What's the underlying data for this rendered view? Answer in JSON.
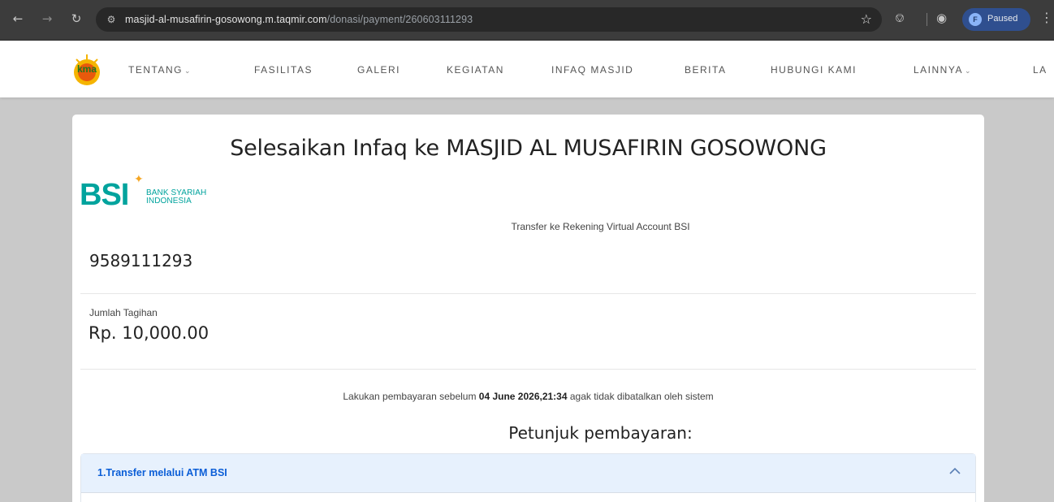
{
  "browser": {
    "url_host": "masjid-al-musafirin-gosowong.m.taqmir.com",
    "url_path": "/donasi/payment/260603111293",
    "profile_initial": "F",
    "profile_status": "Paused",
    "back_icon": "arrow-left-icon",
    "forward_icon": "arrow-right-icon",
    "reload_icon": "reload-icon",
    "site_info_icon": "tune-icon",
    "bookmark_icon": "star-icon",
    "extensions_icon": "puzzle-icon",
    "menu_icon": "kebab-menu-icon"
  },
  "nav": {
    "logo_text": "kma",
    "items": [
      {
        "label": "TENTANG",
        "has_dropdown": true
      },
      {
        "label": "FASILITAS",
        "has_dropdown": false
      },
      {
        "label": "GALERI",
        "has_dropdown": false
      },
      {
        "label": "KEGIATAN",
        "has_dropdown": false
      },
      {
        "label": "INFAQ MASJID",
        "has_dropdown": false
      },
      {
        "label": "BERITA",
        "has_dropdown": false
      },
      {
        "label": "HUBUNGI KAMI",
        "has_dropdown": false
      },
      {
        "label": "LAINNYA",
        "has_dropdown": true
      },
      {
        "label": "LA",
        "has_dropdown": false
      }
    ]
  },
  "payment": {
    "title": "Selesaikan Infaq ke MASJID AL MUSAFIRIN GOSOWONG",
    "bank_logo_letters": "BSI",
    "bank_name_line1": "BANK SYARIAH",
    "bank_name_line2": "INDONESIA",
    "transfer_label": "Transfer ke Rekening Virtual Account BSI",
    "va_number": "9589111293",
    "amount_label": "Jumlah Tagihan",
    "amount": "Rp. 10,000.00",
    "deadline_prefix": "Lakukan pembayaran sebelum ",
    "deadline_datetime": "04 June 2026,21:34",
    "deadline_suffix": " agak tidak dibatalkan oleh sistem",
    "instructions_title": "Petunjuk pembayaran:",
    "accordion_title": "1.Transfer melalui ATM BSI"
  },
  "colors": {
    "bsi_teal": "#00a39d",
    "bsi_orange": "#f5a623",
    "accordion_bg": "#e7f1fd",
    "accordion_text": "#0b5ed7"
  }
}
